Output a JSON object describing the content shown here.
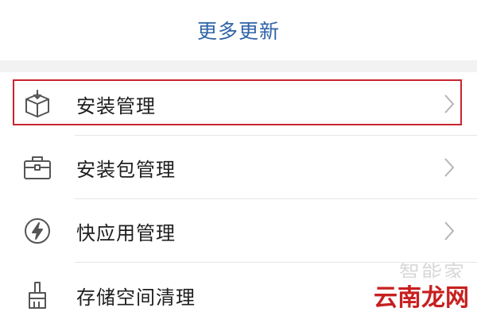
{
  "header": {
    "title": "更多更新"
  },
  "menu": {
    "items": [
      {
        "label": "安装管理",
        "icon": "install-package-icon"
      },
      {
        "label": "安装包管理",
        "icon": "briefcase-icon"
      },
      {
        "label": "快应用管理",
        "icon": "lightning-icon"
      },
      {
        "label": "存储空间清理",
        "icon": "broom-icon"
      }
    ],
    "highlighted_index": 0,
    "highlight_color": "#c8252e"
  },
  "watermark": {
    "top_text": "智能家",
    "bottom_text": "云南龙网"
  },
  "colors": {
    "accent": "#2f63a8",
    "text": "#1e1e1e",
    "icon": "#555555"
  }
}
